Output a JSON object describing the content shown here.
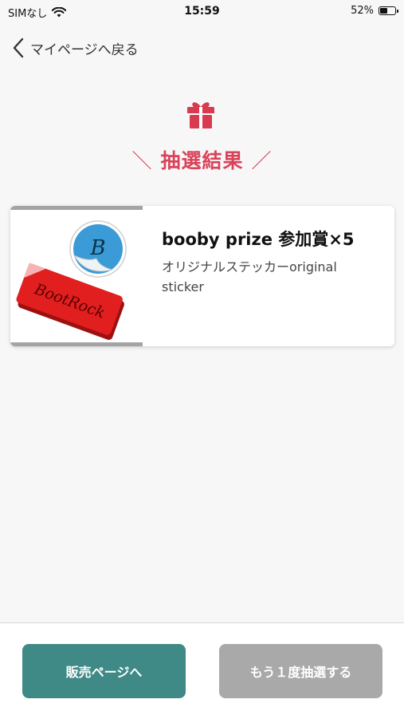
{
  "status_bar": {
    "carrier": "SIMなし",
    "time": "15:59",
    "battery_percent": "52%",
    "battery_level": 0.52,
    "wifi_icon": "wifi-icon"
  },
  "nav": {
    "back_label": "マイページへ戻る",
    "back_icon": "chevron-left-icon"
  },
  "result": {
    "icon": "gift-icon",
    "title": "抽選結果",
    "title_color": "#d9435a"
  },
  "prize": {
    "name": "booby prize 参加賞×5",
    "description": "オリジナルステッカーoriginal sticker",
    "image": "sticker-image",
    "sticker_text": "BootRock"
  },
  "footer": {
    "sales_button_label": "販売ページへ",
    "sales_button_color": "#3f8a86",
    "retry_button_label": "もう１度抽選する",
    "retry_button_color": "#a9a9a9"
  }
}
